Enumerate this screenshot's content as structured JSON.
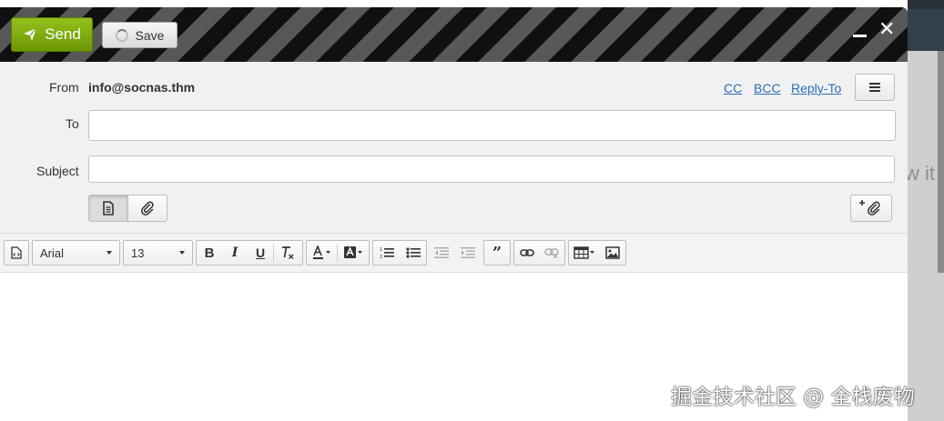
{
  "toolbar": {
    "send_label": "Send",
    "save_label": "Save"
  },
  "fields": {
    "from_label": "From",
    "from_value": "info@socnas.thm",
    "to_label": "To",
    "to_value": "",
    "subject_label": "Subject",
    "subject_value": ""
  },
  "links": {
    "cc": "CC",
    "bcc": "BCC",
    "reply_to": "Reply-To"
  },
  "editor_toolbar": {
    "font_family": "Arial",
    "font_size": "13"
  },
  "background": {
    "partial_text": "w it"
  },
  "watermark": "掘金技术社区 @ 全栈废物",
  "colors": {
    "send_button": "#7aa60c",
    "link": "#2a6fb5",
    "panel": "#f1f1f1"
  },
  "icons": [
    "send-icon",
    "spinner-icon",
    "minimize-icon",
    "close-icon",
    "menu-icon",
    "document-icon",
    "paperclip-icon",
    "attach-plus-icon",
    "source-icon",
    "bold-icon",
    "italic-icon",
    "underline-icon",
    "clear-format-icon",
    "text-color-icon",
    "background-color-icon",
    "ordered-list-icon",
    "unordered-list-icon",
    "outdent-icon",
    "indent-icon",
    "blockquote-icon",
    "link-icon",
    "unlink-icon",
    "table-icon",
    "image-icon"
  ]
}
